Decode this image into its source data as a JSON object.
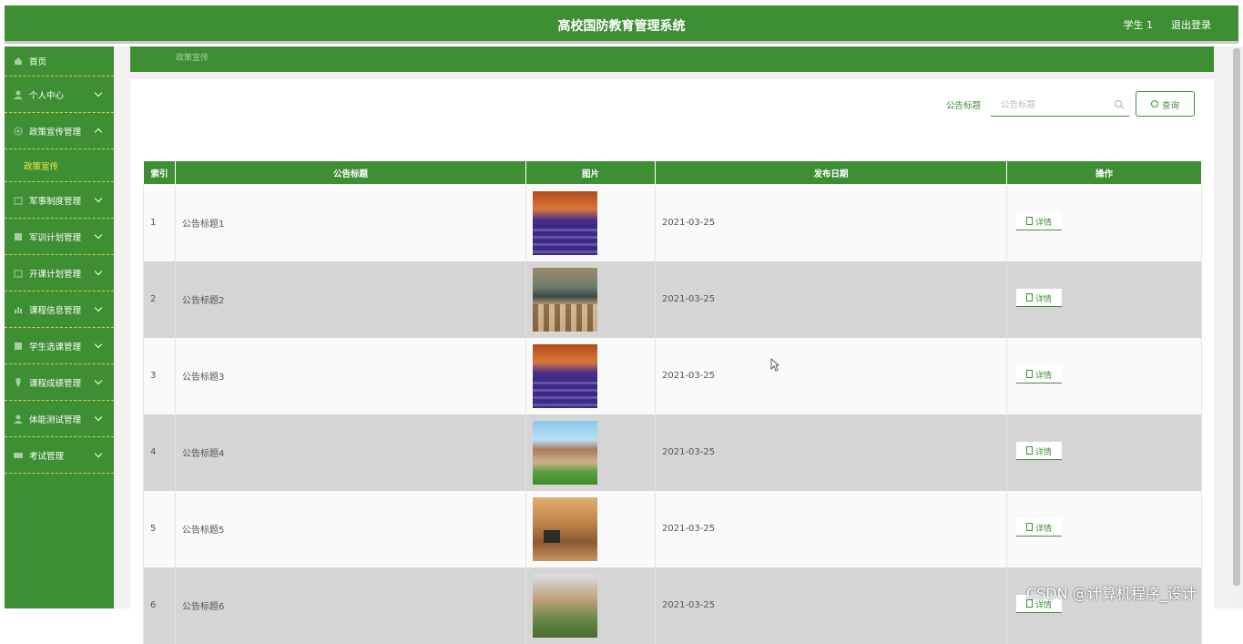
{
  "header": {
    "title": "高校国防教育管理系统",
    "user": "学生 1",
    "logout": "退出登录"
  },
  "sidebar": {
    "items": [
      {
        "label": "首页",
        "icon": "home-icon"
      },
      {
        "label": "个人中心",
        "icon": "user-icon"
      },
      {
        "label": "政策宣传管理",
        "icon": "policy-icon",
        "expanded": true,
        "children": [
          {
            "label": "政策宣传",
            "active": true
          }
        ]
      },
      {
        "label": "军事制度管理",
        "icon": "calendar-icon"
      },
      {
        "label": "军训计划管理",
        "icon": "chart-icon"
      },
      {
        "label": "开课计划管理",
        "icon": "calendar-icon"
      },
      {
        "label": "课程信息管理",
        "icon": "bar-chart-icon"
      },
      {
        "label": "学生选课管理",
        "icon": "list-icon"
      },
      {
        "label": "课程成绩管理",
        "icon": "location-icon"
      },
      {
        "label": "体能测试管理",
        "icon": "user-icon"
      },
      {
        "label": "考试管理",
        "icon": "card-icon"
      }
    ]
  },
  "breadcrumb": "政策宣传",
  "search": {
    "label": "公告标题",
    "placeholder": "公告标题",
    "button": "查询"
  },
  "table": {
    "columns": [
      "索引",
      "公告标题",
      "图片",
      "发布日期",
      "操作"
    ],
    "rows": [
      {
        "index": "1",
        "title": "公告标题1",
        "image": "lecture-hall",
        "date": "2021-03-25",
        "action": "详情"
      },
      {
        "index": "2",
        "title": "公告标题2",
        "image": "classroom",
        "date": "2021-03-25",
        "action": "详情"
      },
      {
        "index": "3",
        "title": "公告标题3",
        "image": "lecture-hall",
        "date": "2021-03-25",
        "action": "详情"
      },
      {
        "index": "4",
        "title": "公告标题4",
        "image": "campus-building",
        "date": "2021-03-25",
        "action": "详情"
      },
      {
        "index": "5",
        "title": "公告标题5",
        "image": "dorm-room",
        "date": "2021-03-25",
        "action": "详情"
      },
      {
        "index": "6",
        "title": "公告标题6",
        "image": "pavilion",
        "date": "2021-03-25",
        "action": "详情"
      }
    ]
  },
  "watermark": "CSDN @计算机程序_设计",
  "colors": {
    "primary": "#3e8f34",
    "accent": "#f5e64a",
    "row_alt": "#d6d5d6"
  }
}
